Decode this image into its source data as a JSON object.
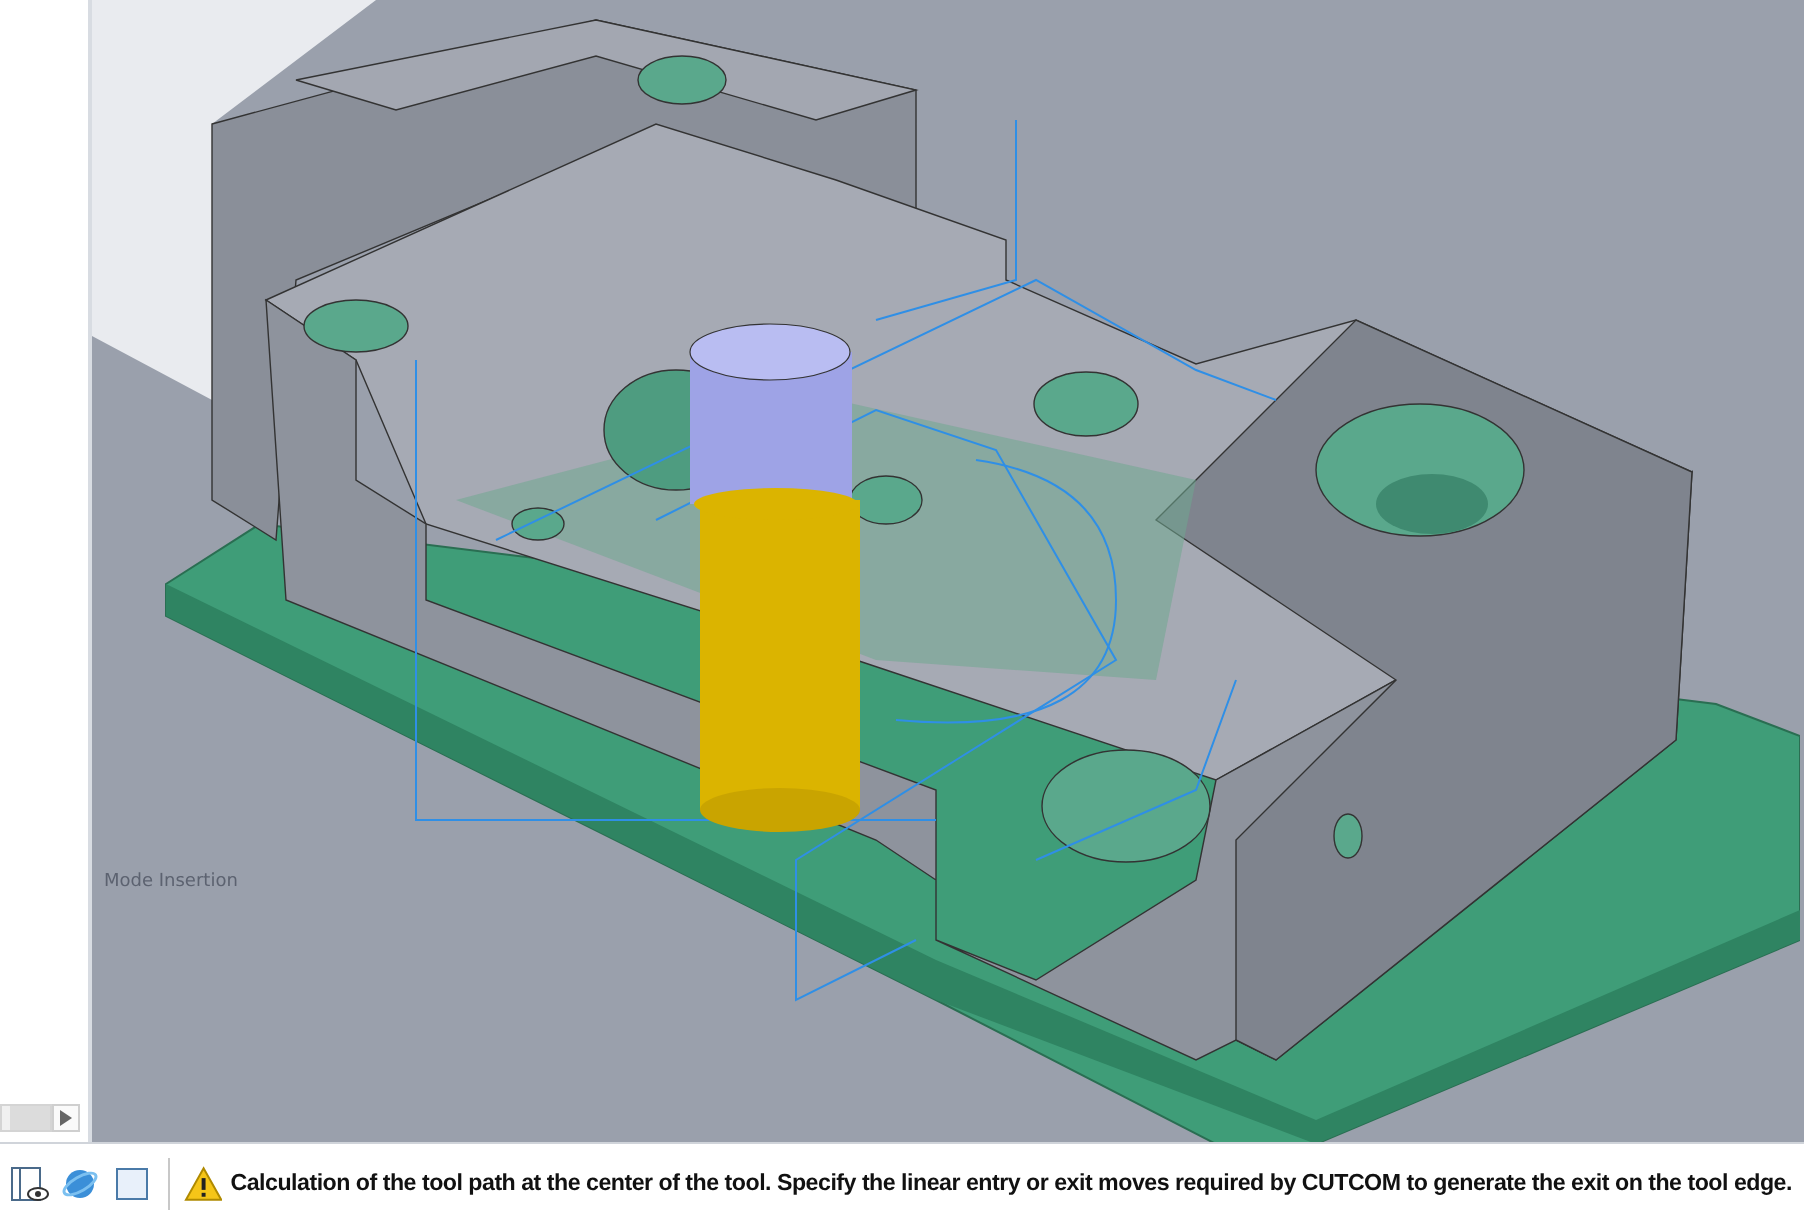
{
  "viewport": {
    "mode_label": "Mode Insertion"
  },
  "status_bar": {
    "message": "Calculation of the tool path at the center of the tool. Specify the linear entry or exit moves required by CUTCOM to generate the exit on the tool edge."
  }
}
